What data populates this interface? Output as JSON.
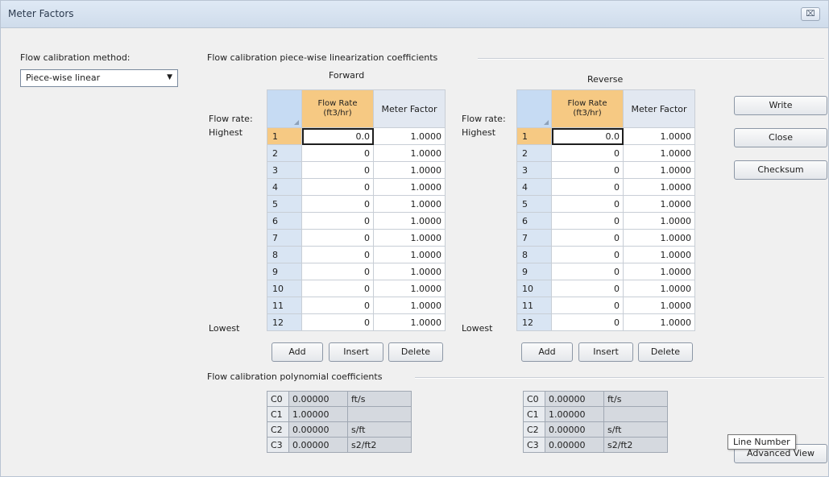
{
  "window": {
    "title": "Meter Factors",
    "close_symbol": "⌧"
  },
  "method": {
    "label": "Flow calibration method:",
    "selected": "Piece-wise linear"
  },
  "pwl": {
    "group_label": "Flow calibration piece-wise linearization coefficients",
    "forward_title": "Forward",
    "reverse_title": "Reverse",
    "flow_rate_label": "Flow rate:",
    "highest": "Highest",
    "lowest": "Lowest",
    "col_flow": "Flow Rate\n(ft3/hr)",
    "col_meter": "Meter Factor",
    "rows": [
      {
        "n": "1",
        "flow": "0.0",
        "factor": "1.0000"
      },
      {
        "n": "2",
        "flow": "0",
        "factor": "1.0000"
      },
      {
        "n": "3",
        "flow": "0",
        "factor": "1.0000"
      },
      {
        "n": "4",
        "flow": "0",
        "factor": "1.0000"
      },
      {
        "n": "5",
        "flow": "0",
        "factor": "1.0000"
      },
      {
        "n": "6",
        "flow": "0",
        "factor": "1.0000"
      },
      {
        "n": "7",
        "flow": "0",
        "factor": "1.0000"
      },
      {
        "n": "8",
        "flow": "0",
        "factor": "1.0000"
      },
      {
        "n": "9",
        "flow": "0",
        "factor": "1.0000"
      },
      {
        "n": "10",
        "flow": "0",
        "factor": "1.0000"
      },
      {
        "n": "11",
        "flow": "0",
        "factor": "1.0000"
      },
      {
        "n": "12",
        "flow": "0",
        "factor": "1.0000"
      }
    ],
    "buttons": {
      "add": "Add",
      "insert": "Insert",
      "delete": "Delete"
    }
  },
  "side_buttons": {
    "write": "Write",
    "close": "Close",
    "checksum": "Checksum",
    "advanced": "Advanced View"
  },
  "poly": {
    "group_label": "Flow calibration polynomial coefficients",
    "rows": [
      {
        "k": "C0",
        "v": "0.00000",
        "u": "ft/s"
      },
      {
        "k": "C1",
        "v": "1.00000",
        "u": ""
      },
      {
        "k": "C2",
        "v": "0.00000",
        "u": "s/ft"
      },
      {
        "k": "C3",
        "v": "0.00000",
        "u": "s2/ft2"
      }
    ]
  },
  "tooltip": "Line Number"
}
